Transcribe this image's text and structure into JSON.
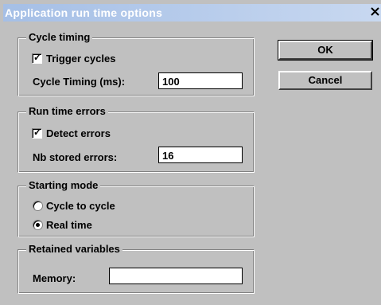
{
  "window": {
    "title": "Application run time options",
    "close_glyph": "✕"
  },
  "buttons": {
    "ok": "OK",
    "cancel": "Cancel"
  },
  "cycle_timing": {
    "legend": "Cycle timing",
    "trigger_label": "Trigger cycles",
    "trigger_checked": true,
    "timing_label": "Cycle Timing (ms):",
    "timing_value": "100"
  },
  "run_time_errors": {
    "legend": "Run time errors",
    "detect_label": "Detect errors",
    "detect_checked": true,
    "stored_label": "Nb stored errors:",
    "stored_value": "16"
  },
  "starting_mode": {
    "legend": "Starting mode",
    "options": [
      {
        "label": "Cycle to cycle",
        "selected": false
      },
      {
        "label": "Real time",
        "selected": true
      }
    ]
  },
  "retained_variables": {
    "legend": "Retained variables",
    "memory_label": "Memory:",
    "memory_value": ""
  }
}
